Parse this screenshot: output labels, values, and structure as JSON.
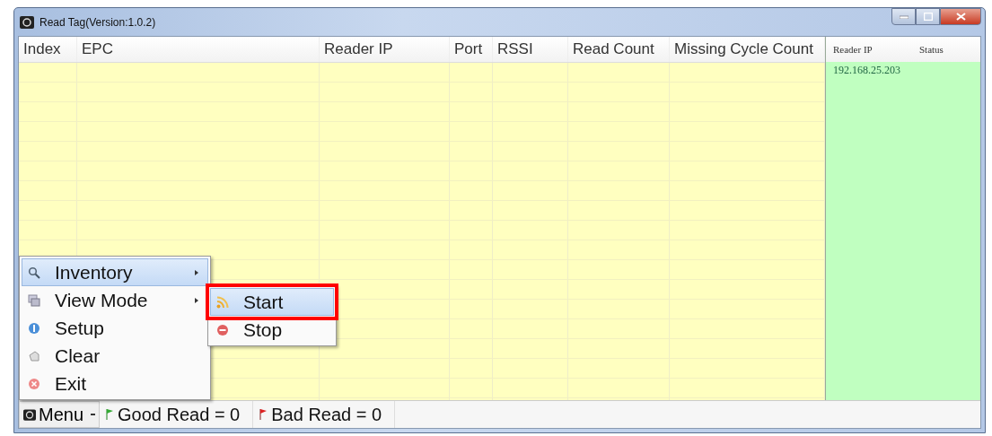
{
  "window": {
    "title": "Read Tag(Version:1.0.2)"
  },
  "table": {
    "columns": [
      "Index",
      "EPC",
      "Reader IP",
      "Port",
      "RSSI",
      "Read Count",
      "Missing Cycle Count"
    ]
  },
  "reader_panel": {
    "columns": [
      "Reader IP",
      "Status"
    ],
    "rows": [
      {
        "reader_ip": "192.168.25.203"
      }
    ]
  },
  "context_menu": {
    "items": [
      {
        "label": "Inventory",
        "has_submenu": true,
        "selected": true
      },
      {
        "label": "View Mode",
        "has_submenu": true,
        "selected": false
      },
      {
        "label": "Setup",
        "has_submenu": false,
        "selected": false
      },
      {
        "label": "Clear",
        "has_submenu": false,
        "selected": false
      },
      {
        "label": "Exit",
        "has_submenu": false,
        "selected": false
      }
    ]
  },
  "submenu": {
    "items": [
      {
        "label": "Start",
        "selected": true,
        "outlined": true
      },
      {
        "label": "Stop",
        "selected": false,
        "outlined": false
      }
    ]
  },
  "status_bar": {
    "menu_button": "Menu",
    "good_read": "Good Read = 0",
    "bad_read": "Bad Read = 0"
  }
}
